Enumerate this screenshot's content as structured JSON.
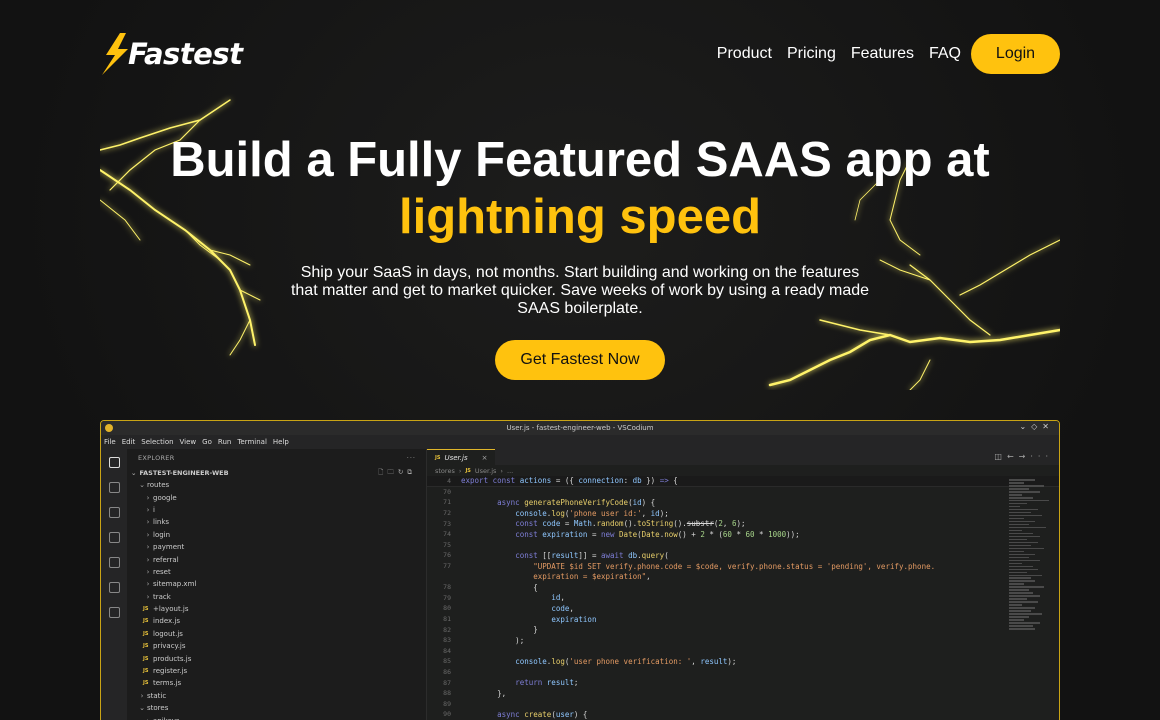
{
  "brand": {
    "name": "Fastest",
    "accent": "#ffc20e"
  },
  "nav": {
    "items": [
      "Product",
      "Pricing",
      "Features",
      "FAQ"
    ],
    "login_label": "Login"
  },
  "hero": {
    "title_line1": "Build a Fully Featured SAAS app at",
    "title_line2": "lightning speed",
    "subtitle": "Ship your SaaS in days, not months. Start building and working on the features that matter and get to market quicker. Save weeks of work by using a ready made SAAS boilerplate.",
    "cta_label": "Get Fastest Now"
  },
  "editor": {
    "window_title": "User.js - fastest-engineer-web - VSCodium",
    "menu": [
      "File",
      "Edit",
      "Selection",
      "View",
      "Go",
      "Run",
      "Terminal",
      "Help"
    ],
    "explorer_label": "EXPLORER",
    "project_name": "FASTEST-ENGINEER-WEB",
    "tree": [
      {
        "label": "routes",
        "type": "folder-open",
        "depth": 1
      },
      {
        "label": "google",
        "type": "folder",
        "depth": 2
      },
      {
        "label": "i",
        "type": "folder",
        "depth": 2
      },
      {
        "label": "links",
        "type": "folder",
        "depth": 2
      },
      {
        "label": "login",
        "type": "folder",
        "depth": 2
      },
      {
        "label": "payment",
        "type": "folder",
        "depth": 2
      },
      {
        "label": "referral",
        "type": "folder",
        "depth": 2
      },
      {
        "label": "reset",
        "type": "folder",
        "depth": 2
      },
      {
        "label": "sitemap.xml",
        "type": "folder",
        "depth": 2
      },
      {
        "label": "track",
        "type": "folder",
        "depth": 2
      },
      {
        "label": "+layout.js",
        "type": "js",
        "depth": 2
      },
      {
        "label": "index.js",
        "type": "js",
        "depth": 2
      },
      {
        "label": "logout.js",
        "type": "js",
        "depth": 2
      },
      {
        "label": "privacy.js",
        "type": "js",
        "depth": 2
      },
      {
        "label": "products.js",
        "type": "js",
        "depth": 2
      },
      {
        "label": "register.js",
        "type": "js",
        "depth": 2
      },
      {
        "label": "terms.js",
        "type": "js",
        "depth": 2
      },
      {
        "label": "static",
        "type": "folder",
        "depth": 1
      },
      {
        "label": "stores",
        "type": "folder-open",
        "depth": 1
      },
      {
        "label": "apikeys",
        "type": "folder",
        "depth": 2
      }
    ],
    "tab_label": "User.js",
    "breadcrumbs": [
      "stores",
      "User.js",
      "..."
    ],
    "sticky_line": {
      "ln": "4",
      "html": "<span class=\"kw\">export const</span> <span class=\"var\">actions</span> = ({ <span class=\"var\">connection</span>: <span class=\"var\">db</span> }) <span class=\"kw\">=></span> {"
    },
    "code_lines": [
      {
        "ln": "70",
        "html": ""
      },
      {
        "ln": "71",
        "html": "        <span class=\"kw\">async</span> <span class=\"fn\">generatePhoneVerifyCode</span>(<span class=\"var\">id</span>) {"
      },
      {
        "ln": "72",
        "html": "            <span class=\"var\">console</span>.<span class=\"fn\">log</span>(<span class=\"str\">'phone user id:'</span>, <span class=\"var\">id</span>);"
      },
      {
        "ln": "73",
        "html": "            <span class=\"kw\">const</span> <span class=\"var\">code</span> = <span class=\"var\">Math</span>.<span class=\"fn\">random</span>().<span class=\"fn\">toString</span>().<s>substr</s>(<span class=\"num\">2</span>, <span class=\"num\">6</span>);"
      },
      {
        "ln": "74",
        "html": "            <span class=\"kw\">const</span> <span class=\"var\">expiration</span> = <span class=\"kw\">new</span> <span class=\"fn\">Date</span>(<span class=\"fn\">Date</span>.<span class=\"fn\">now</span>() + <span class=\"num\">2</span> * (<span class=\"num\">60</span> * <span class=\"num\">60</span> * <span class=\"num\">1000</span>));"
      },
      {
        "ln": "75",
        "html": ""
      },
      {
        "ln": "76",
        "html": "            <span class=\"kw\">const</span> [[<span class=\"var\">result</span>]] = <span class=\"kw\">await</span> <span class=\"var\">db</span>.<span class=\"fn\">query</span>("
      },
      {
        "ln": "77",
        "html": "                <span class=\"str\">\"UPDATE $id SET verify.phone.code = $code, verify.phone.status = 'pending', verify.phone.</span>"
      },
      {
        "ln": "",
        "html": "                <span class=\"str\">expiration = $expiration\"</span>,"
      },
      {
        "ln": "78",
        "html": "                {"
      },
      {
        "ln": "79",
        "html": "                    <span class=\"var\">id</span>,"
      },
      {
        "ln": "80",
        "html": "                    <span class=\"var\">code</span>,"
      },
      {
        "ln": "81",
        "html": "                    <span class=\"var\">expiration</span>"
      },
      {
        "ln": "82",
        "html": "                }"
      },
      {
        "ln": "83",
        "html": "            );"
      },
      {
        "ln": "84",
        "html": ""
      },
      {
        "ln": "85",
        "html": "            <span class=\"var\">console</span>.<span class=\"fn\">log</span>(<span class=\"str\">'user phone verification: '</span>, <span class=\"var\">result</span>);"
      },
      {
        "ln": "86",
        "html": ""
      },
      {
        "ln": "87",
        "html": "            <span class=\"kw\">return</span> <span class=\"var\">result</span>;"
      },
      {
        "ln": "88",
        "html": "        },"
      },
      {
        "ln": "89",
        "html": ""
      },
      {
        "ln": "90",
        "html": "        <span class=\"kw\">async</span> <span class=\"fn\">create</span>(<span class=\"var\">user</span>) {"
      }
    ]
  }
}
